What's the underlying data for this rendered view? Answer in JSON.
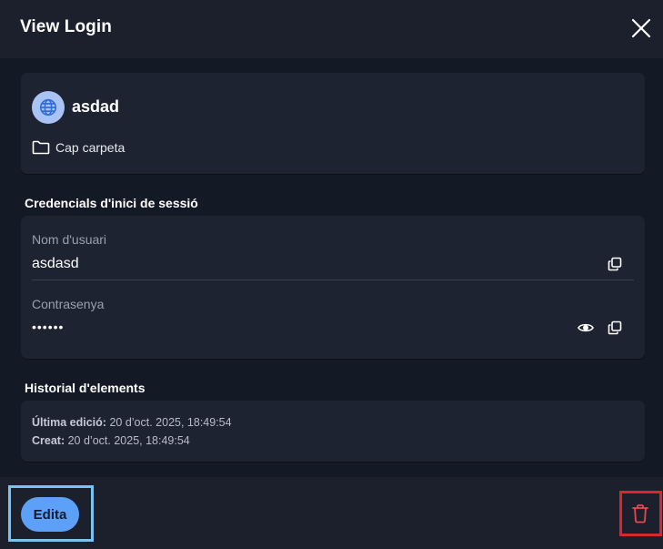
{
  "dialog": {
    "title": "View Login",
    "close_icon": "close-icon"
  },
  "item": {
    "name": "asdad",
    "icon": "globe-icon",
    "folder_icon": "folder-icon",
    "folder_label": "Cap carpeta"
  },
  "credentials": {
    "section_title": "Credencials d'inici de sessió",
    "username_label": "Nom d'usuari",
    "username_value": "asdasd",
    "password_label": "Contrasenya",
    "password_value": "••••••",
    "copy_icon": "copy-icon",
    "show_password_icon": "eye-icon"
  },
  "history": {
    "section_title": "Historial d'elements",
    "last_edited_label": "Última edició:",
    "last_edited_value": "20 d’oct. 2025, 18:49:54",
    "created_label": "Creat:",
    "created_value": "20 d’oct. 2025, 18:49:54"
  },
  "footer": {
    "edit_label": "Edita",
    "delete_icon": "trash-icon"
  },
  "colors": {
    "background": "#141926",
    "card": "#1e2331",
    "accent": "#5da0f7",
    "danger": "#e5484d"
  }
}
